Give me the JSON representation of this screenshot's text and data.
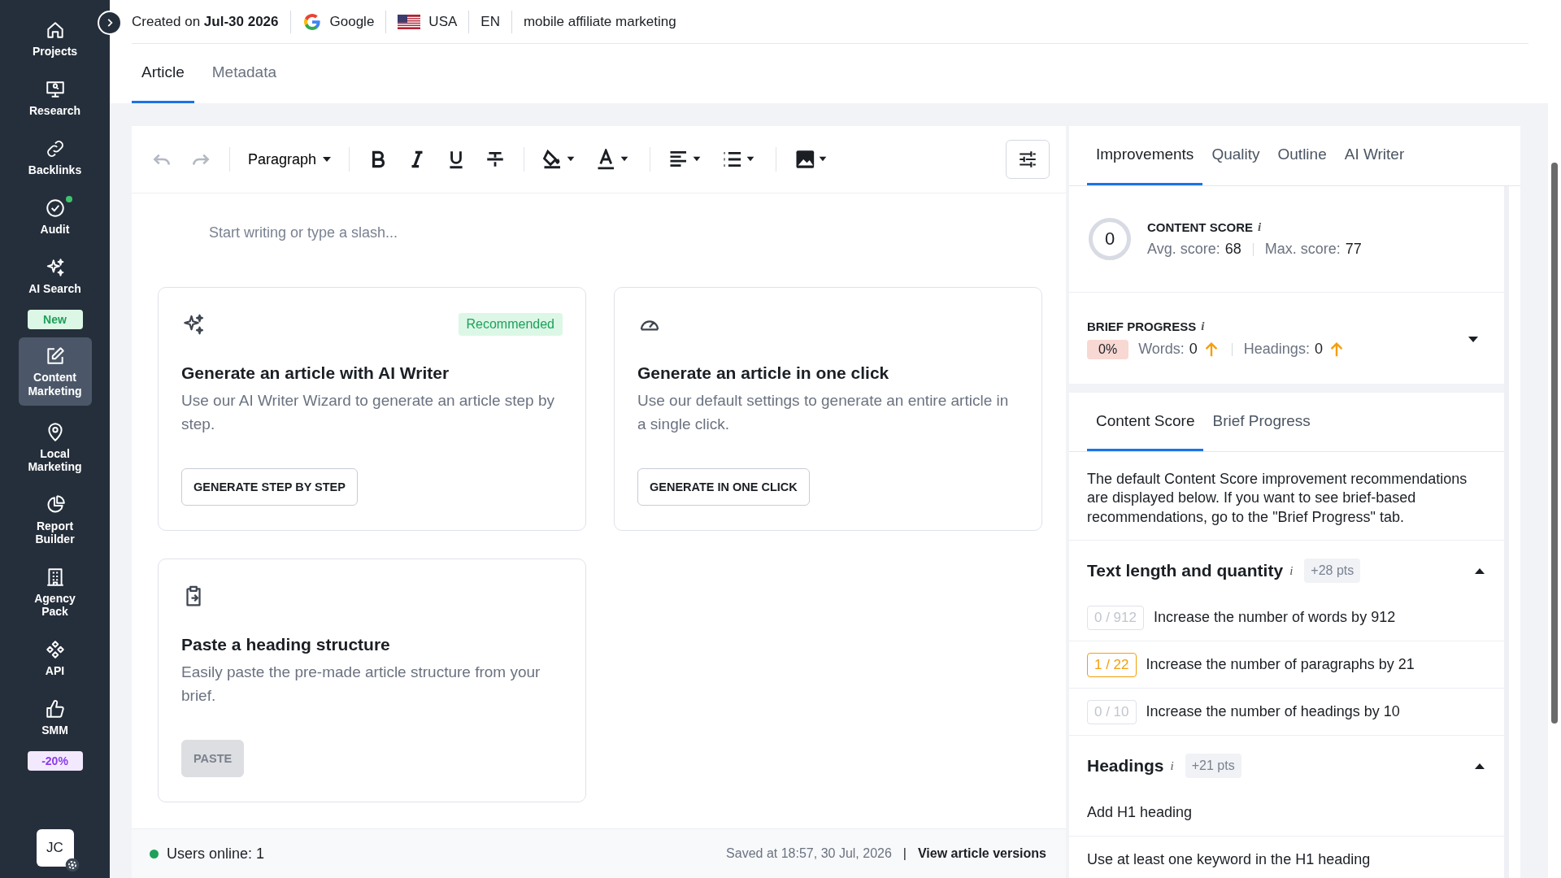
{
  "sidebar": {
    "items": [
      {
        "label": "Projects",
        "selected": false,
        "notification": false
      },
      {
        "label": "Research",
        "selected": false,
        "notification": false
      },
      {
        "label": "Backlinks",
        "selected": false,
        "notification": false
      },
      {
        "label": "Audit",
        "selected": false,
        "notification": true
      },
      {
        "label": "AI Search",
        "selected": false,
        "notification": false,
        "badge": {
          "text": "New",
          "kind": "new"
        }
      },
      {
        "label": "Content Marketing",
        "selected": true,
        "notification": false
      },
      {
        "label": "Local Marketing",
        "selected": false,
        "notification": false
      },
      {
        "label": "Report Builder",
        "selected": false,
        "notification": false
      },
      {
        "label": "Agency Pack",
        "selected": false,
        "notification": false
      },
      {
        "label": "API",
        "selected": false,
        "notification": false
      },
      {
        "label": "SMM",
        "selected": false,
        "notification": false,
        "badge": {
          "text": "-20%",
          "kind": "discount"
        }
      }
    ],
    "avatar": "JC"
  },
  "header": {
    "created_label": "Created on",
    "created_date": "Jul-30 2026",
    "engine": "Google",
    "country": "USA",
    "language": "EN",
    "keyword": "mobile affiliate marketing"
  },
  "tabs": [
    {
      "label": "Article",
      "selected": true
    },
    {
      "label": "Metadata",
      "selected": false
    }
  ],
  "toolbar": {
    "undo_disabled": true,
    "redo_disabled": true,
    "block_style": "Paragraph"
  },
  "editor": {
    "placeholder": "Start writing or type a slash...",
    "cards": [
      {
        "title": "Generate an article with AI Writer",
        "description": "Use our AI Writer Wizard to generate an article step by step.",
        "badge": "Recommended",
        "button": {
          "label": "GENERATE STEP BY STEP",
          "disabled": false
        }
      },
      {
        "title": "Generate an article in one click",
        "description": "Use our default settings to generate an entire article in a single click.",
        "button": {
          "label": "GENERATE IN ONE CLICK",
          "disabled": false
        }
      },
      {
        "title": "Paste a heading structure",
        "description": "Easily paste the pre-made article structure from your brief.",
        "button": {
          "label": "PASTE",
          "disabled": true
        }
      }
    ]
  },
  "footer": {
    "users_online": "Users online: 1",
    "saved": "Saved at 18:57, 30 Jul, 2026",
    "separator": "|",
    "versions_link": "View article versions"
  },
  "panel": {
    "tabs": [
      {
        "label": "Improvements",
        "selected": true
      },
      {
        "label": "Quality",
        "selected": false
      },
      {
        "label": "Outline",
        "selected": false
      },
      {
        "label": "AI Writer",
        "selected": false
      }
    ],
    "content_score": {
      "title": "CONTENT SCORE",
      "info": "i",
      "score": "0",
      "avg_label": "Avg. score:",
      "avg": "68",
      "max_label": "Max. score:",
      "max": "77"
    },
    "brief_progress": {
      "title": "BRIEF PROGRESS",
      "info": "i",
      "percent": "0%",
      "words_label": "Words:",
      "words": "0",
      "headings_label": "Headings:",
      "headings": "0",
      "expanded": false
    },
    "subtabs": [
      {
        "label": "Content Score",
        "selected": true
      },
      {
        "label": "Brief Progress",
        "selected": false
      }
    ],
    "description": "The default Content Score improvement recommendations are displayed below. If you want to see brief-based recommendations, go to the \"Brief Progress\" tab.",
    "sections": [
      {
        "title": "Text length and quantity",
        "info": "i",
        "pts": "+28 pts",
        "expanded": true,
        "items": [
          {
            "progress": "0 / 912",
            "kind": "empty",
            "text": "Increase the number of words by 912"
          },
          {
            "progress": "1 / 22",
            "kind": "partial",
            "text": "Increase the number of paragraphs by 21"
          },
          {
            "progress": "0 / 10",
            "kind": "empty",
            "text": "Increase the number of headings by 10"
          }
        ]
      },
      {
        "title": "Headings",
        "info": "i",
        "pts": "+21 pts",
        "expanded": true,
        "items": [
          {
            "text": "Add H1 heading"
          },
          {
            "text": "Use at least one keyword in the H1 heading"
          }
        ]
      }
    ]
  }
}
